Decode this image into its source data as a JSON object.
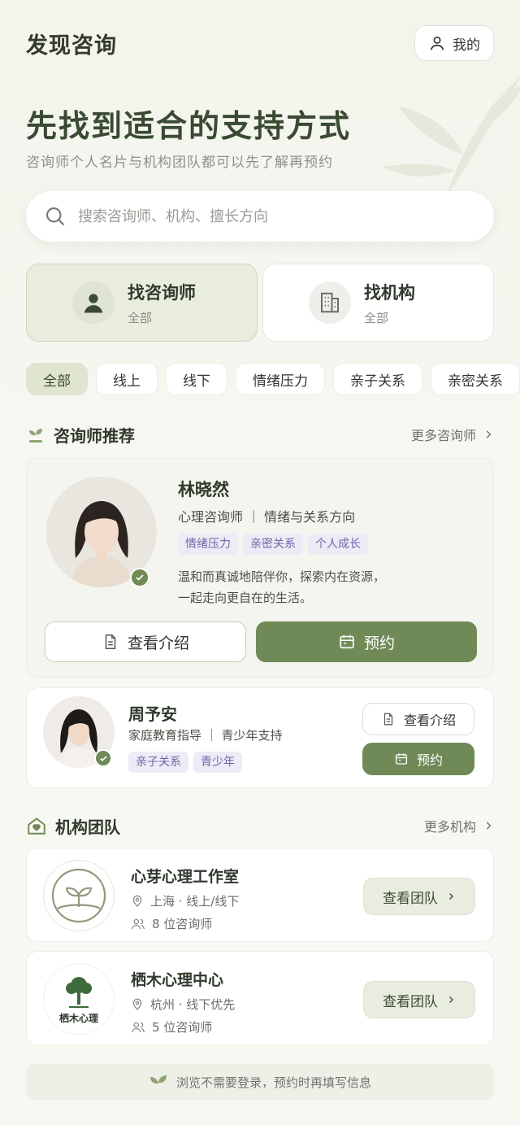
{
  "header": {
    "title": "发现咨询",
    "me_label": "我的"
  },
  "hero": {
    "headline": "先找到适合的支持方式",
    "subline": "咨询师个人名片与机构团队都可以先了解再预约"
  },
  "search": {
    "placeholder": "搜索咨询师、机构、擅长方向"
  },
  "modes": [
    {
      "title": "找咨询师",
      "sub": "全部",
      "active": true
    },
    {
      "title": "找机构",
      "sub": "全部",
      "active": false
    }
  ],
  "chips": [
    "全部",
    "线上",
    "线下",
    "情绪压力",
    "亲子关系",
    "亲密关系"
  ],
  "counselors_section": {
    "title": "咨询师推荐",
    "more": "更多咨询师"
  },
  "counselors": [
    {
      "name": "林晓然",
      "role": "心理咨询师 ｜ 情绪与关系方向",
      "tags": [
        "情绪压力",
        "亲密关系",
        "个人成长"
      ],
      "desc_line1": "温和而真诚地陪伴你，探索内在资源，",
      "desc_line2": "一起走向更自在的生活。",
      "intro_label": "查看介绍",
      "book_label": "预约"
    },
    {
      "name": "周予安",
      "role": "家庭教育指导 ｜ 青少年支持",
      "tags": [
        "亲子关系",
        "青少年"
      ],
      "intro_label": "查看介绍",
      "book_label": "预约"
    }
  ],
  "orgs_section": {
    "title": "机构团队",
    "more": "更多机构"
  },
  "orgs": [
    {
      "name": "心芽心理工作室",
      "location": "上海 · 线上/线下",
      "count": "8 位咨询师",
      "button": "查看团队"
    },
    {
      "name": "栖木心理中心",
      "logo_text": "栖木心理",
      "location": "杭州 · 线下优先",
      "count": "5 位咨询师",
      "button": "查看团队"
    }
  ],
  "footer": {
    "note": "浏览不需要登录，预约时再填写信息"
  },
  "colors": {
    "primary": "#6f8a57",
    "tag_bg": "#ecebf6",
    "tag_text": "#6f66a8",
    "active_bg": "#e9eddd"
  }
}
